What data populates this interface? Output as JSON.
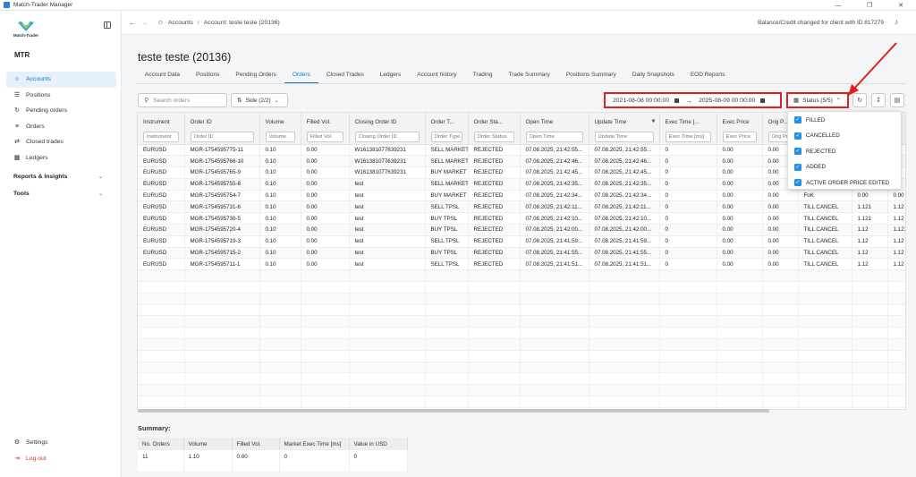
{
  "window": {
    "title": "Match-Trader Manager",
    "controls": [
      "—",
      "❐",
      "✕"
    ]
  },
  "sidebar": {
    "logo_text": "Match-Trader",
    "brand": "MTR",
    "items": [
      {
        "label": "Accounts",
        "icon": "users-icon",
        "active": true
      },
      {
        "label": "Positions",
        "icon": "list-icon"
      },
      {
        "label": "Pending orders",
        "icon": "pending-icon"
      },
      {
        "label": "Orders",
        "icon": "orders-icon"
      },
      {
        "label": "Closed trades",
        "icon": "closed-trades-icon"
      },
      {
        "label": "Ledgers",
        "icon": "ledger-icon"
      }
    ],
    "sections": [
      {
        "label": "Reports & Insights"
      },
      {
        "label": "Tools"
      }
    ],
    "bottom": [
      {
        "label": "Settings",
        "icon": "gear-icon"
      },
      {
        "label": "Log out",
        "icon": "logout-icon"
      }
    ]
  },
  "header": {
    "breadcrumb": {
      "root": "Accounts",
      "current": "Account: teste teste (20136)"
    },
    "notification": "Balance/Credit changed for client with ID 817279"
  },
  "page": {
    "title": "teste teste (20136)",
    "tabs": [
      "Account Data",
      "Positions",
      "Pending Orders",
      "Orders",
      "Closed Trades",
      "Ledgers",
      "Account history",
      "Trading",
      "Trade Summary",
      "Positions Summary",
      "Daily Snapshots",
      "EOD Reports"
    ],
    "active_tab": "Orders"
  },
  "toolbar": {
    "search_placeholder": "Search orders",
    "side_label": "Side (2/2)",
    "date_from": "2021-08-08 00:00:00",
    "date_to": "2025-08-09 00:00:00",
    "status_label": "Status (5/5)"
  },
  "status_menu": {
    "options": [
      "FILLED",
      "CANCELLED",
      "REJECTED",
      "ADDED",
      "ACTIVE ORDER PRICE EDITED"
    ]
  },
  "table": {
    "columns": [
      {
        "header": "Instrument",
        "filter": "Instrument"
      },
      {
        "header": "Order ID",
        "filter": "Order ID"
      },
      {
        "header": "Volume",
        "filter": "Volume"
      },
      {
        "header": "Filled Vol.",
        "filter": "Filled Vol."
      },
      {
        "header": "Closing Order ID",
        "filter": "Closing Order ID"
      },
      {
        "header": "Order T...",
        "filter": "Order Type"
      },
      {
        "header": "Order Sta...",
        "filter": "Order Status"
      },
      {
        "header": "Open Time",
        "filter": "Open Time"
      },
      {
        "header": "Update Time",
        "filter": "Update Time"
      },
      {
        "header": "Exec Time [...",
        "filter": "Exec Time [ms]"
      },
      {
        "header": "Exec Price",
        "filter": "Exec Price"
      },
      {
        "header": "Orig P...",
        "filter": "Orig Price"
      },
      {
        "header": "",
        "filter": ""
      },
      {
        "header": "",
        "filter": ""
      },
      {
        "header": "",
        "filter": ""
      }
    ],
    "rows": [
      [
        "EURUSD",
        "MGR-1754595775-11",
        "0.10",
        "0.00",
        "W161381077639231",
        "SELL MARKET",
        "REJECTED",
        "07.08.2025, 21:42:55...",
        "07.08.2025, 21:42:55...",
        "0",
        "0.00",
        "0.00",
        "",
        "",
        ""
      ],
      [
        "EURUSD",
        "MGR-1754595766-10",
        "0.10",
        "0.00",
        "W161381077639231",
        "SELL MARKET",
        "REJECTED",
        "07.08.2025, 21:42:46...",
        "07.08.2025, 21:42:46...",
        "0",
        "0.00",
        "0.00",
        "",
        "",
        ""
      ],
      [
        "EURUSD",
        "MGR-1754595765-9",
        "0.10",
        "0.00",
        "W161381077639231",
        "BUY MARKET",
        "REJECTED",
        "07.08.2025, 21:42:45...",
        "07.08.2025, 21:42:45...",
        "0",
        "0.00",
        "0.00",
        "",
        "",
        ""
      ],
      [
        "EURUSD",
        "MGR-1754595755-8",
        "0.10",
        "0.00",
        "test",
        "SELL MARKET",
        "REJECTED",
        "07.08.2025, 21:42:35...",
        "07.08.2025, 21:42:35...",
        "0",
        "0.00",
        "0.00",
        "",
        "",
        ""
      ],
      [
        "EURUSD",
        "MGR-1754595754-7",
        "0.10",
        "0.00",
        "test",
        "BUY MARKET",
        "REJECTED",
        "07.08.2025, 21:42:34...",
        "07.08.2025, 21:42:34...",
        "0",
        "0.00",
        "0.00",
        "FoK",
        "0.00",
        "0.00"
      ],
      [
        "EURUSD",
        "MGR-1754595731-6",
        "0.10",
        "0.00",
        "test",
        "SELL TPSL",
        "REJECTED",
        "07.08.2025, 21:42:11...",
        "07.08.2025, 21:42:11...",
        "0",
        "0.00",
        "0.00",
        "TILL CANCEL",
        "1.121",
        "1.12"
      ],
      [
        "EURUSD",
        "MGR-1754595730-5",
        "0.10",
        "0.00",
        "test",
        "BUY TPSL",
        "REJECTED",
        "07.08.2025, 21:42:10...",
        "07.08.2025, 21:42:10...",
        "0",
        "0.00",
        "0.00",
        "TILL CANCEL",
        "1.121",
        "1.12"
      ],
      [
        "EURUSD",
        "MGR-1754595720-4",
        "0.10",
        "0.00",
        "test",
        "BUY TPSL",
        "REJECTED",
        "07.08.2025, 21:42:00...",
        "07.08.2025, 21:42:00...",
        "0",
        "0.00",
        "0.00",
        "TILL CANCEL",
        "1.12",
        "1.121"
      ],
      [
        "EURUSD",
        "MGR-1754595719-3",
        "0.10",
        "0.00",
        "test",
        "SELL TPSL",
        "REJECTED",
        "07.08.2025, 21:41:59...",
        "07.08.2025, 21:41:59...",
        "0",
        "0.00",
        "0.00",
        "TILL CANCEL",
        "1.12",
        "1.12"
      ],
      [
        "EURUSD",
        "MGR-1754595715-2",
        "0.10",
        "0.00",
        "test",
        "BUY TPSL",
        "REJECTED",
        "07.08.2025, 21:41:55...",
        "07.08.2025, 21:41:55...",
        "0",
        "0.00",
        "0.00",
        "TILL CANCEL",
        "1.12",
        "1.12"
      ],
      [
        "EURUSD",
        "MGR-1754595711-1",
        "0.10",
        "0.00",
        "test",
        "SELL TPSL",
        "REJECTED",
        "07.08.2025, 21:41:51...",
        "07.08.2025, 21:41:51...",
        "0",
        "0.00",
        "0.00",
        "TILL CANCEL",
        "1.12",
        "1.12"
      ]
    ]
  },
  "summary": {
    "title": "Summary:",
    "headers": [
      "No. Orders",
      "Volume",
      "Filled Vol.",
      "Market Exec Time [ms]",
      "Value in USD"
    ],
    "values": [
      "11",
      "1.10",
      "0.00",
      "0",
      "0"
    ]
  },
  "colors": {
    "accent": "#1f6fc5",
    "highlight": "#e02020",
    "checkbox": "#2a8de0"
  }
}
